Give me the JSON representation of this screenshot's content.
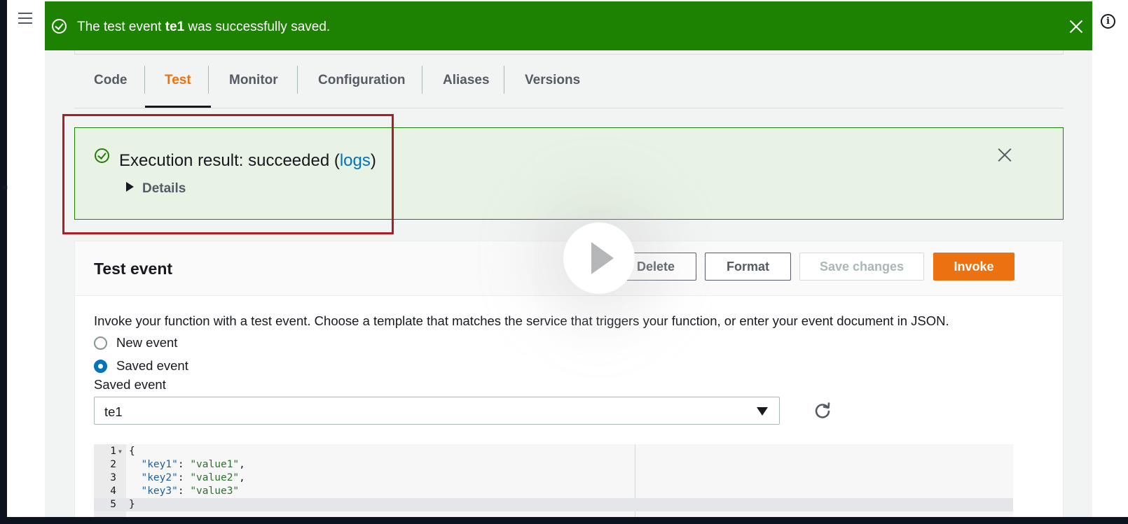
{
  "flash": {
    "prefix": "The test event ",
    "event_name": "te1",
    "suffix": " was successfully saved."
  },
  "tabs": [
    {
      "label": "Code"
    },
    {
      "label": "Test"
    },
    {
      "label": "Monitor"
    },
    {
      "label": "Configuration"
    },
    {
      "label": "Aliases"
    },
    {
      "label": "Versions"
    }
  ],
  "active_tab": "Test",
  "execution_result": {
    "prefix": "Execution result: succeeded (",
    "link": "logs",
    "suffix": ")",
    "details_label": "Details"
  },
  "test_event": {
    "title": "Test event",
    "buttons": {
      "delete": "Delete",
      "format": "Format",
      "save_changes": "Save changes",
      "invoke": "Invoke"
    },
    "description": "Invoke your function with a test event. Choose a template that matches the service that triggers your function, or enter your event document in JSON.",
    "radio_new": "New event",
    "radio_saved": "Saved event",
    "selected_radio": "Saved event",
    "field_label": "Saved event",
    "select_value": "te1"
  },
  "editor": {
    "lines": [
      {
        "num": "1",
        "text": "{"
      },
      {
        "num": "2",
        "key": "\"key1\"",
        "value": "\"value1\"",
        "tail": ","
      },
      {
        "num": "3",
        "key": "\"key2\"",
        "value": "\"value2\"",
        "tail": ","
      },
      {
        "num": "4",
        "key": "\"key3\"",
        "value": "\"value3\"",
        "tail": ""
      },
      {
        "num": "5",
        "text": "}"
      }
    ]
  },
  "colors": {
    "success": "#1d8102",
    "accent": "#ec7211",
    "link": "#0073bb",
    "highlight": "#a81f26"
  },
  "icons": [
    "menu-icon",
    "check-circle-icon",
    "close-icon",
    "info-icon",
    "caret-right-icon",
    "caret-down-icon",
    "refresh-icon",
    "play-icon"
  ]
}
